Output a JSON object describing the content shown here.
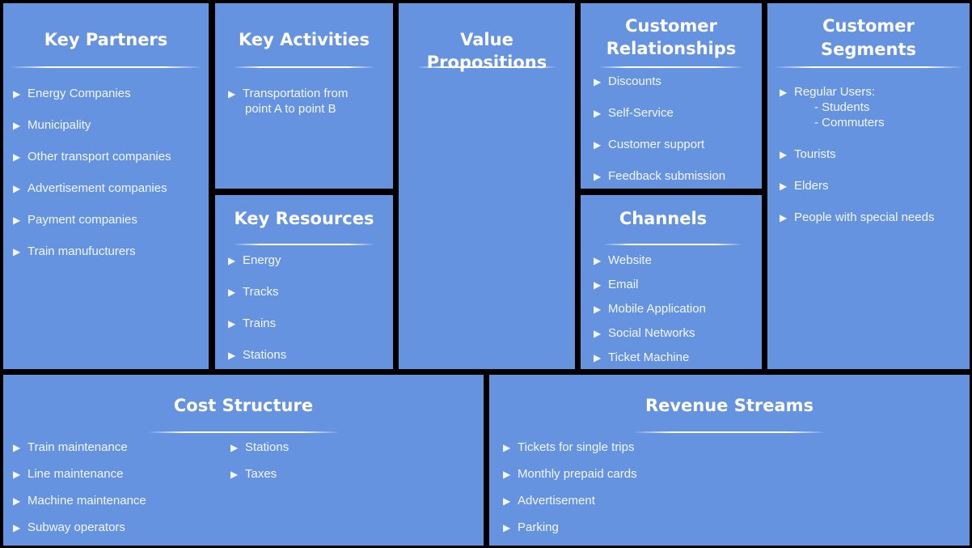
{
  "key_partners": {
    "title": "Key Partners",
    "items": [
      "Energy Companies",
      "Municipality",
      "Other transport companies",
      "Advertisement companies",
      "Payment companies",
      "Train manufucturers"
    ]
  },
  "key_activities": {
    "title": "Key Activities",
    "item_line1": "Transportation from",
    "item_line2": "point A to point B"
  },
  "key_resources": {
    "title": "Key Resources",
    "items": [
      "Energy",
      "Tracks",
      "Trains",
      "Stations"
    ]
  },
  "value_propositions": {
    "title": "Value Propositions"
  },
  "customer_relationships": {
    "title_line1": "Customer",
    "title_line2": "Relationships",
    "items": [
      "Discounts",
      "Self-Service",
      "Customer support",
      "Feedback submission"
    ]
  },
  "channels": {
    "title": "Channels",
    "items": [
      "Website",
      "Email",
      "Mobile Application",
      "Social Networks",
      "Ticket Machine"
    ]
  },
  "customer_segments": {
    "title_line1": "Customer",
    "title_line2": "Segments",
    "regular_users": "Regular Users:",
    "sub_items": [
      "- Students",
      "- Commuters"
    ],
    "items": [
      "Tourists",
      "Elders",
      "People with special needs"
    ]
  },
  "cost_structure": {
    "title": "Cost Structure",
    "col1": [
      "Train maintenance",
      "Line maintenance",
      "Machine maintenance",
      "Subway operators"
    ],
    "col2": [
      "Stations",
      "Taxes"
    ]
  },
  "revenue_streams": {
    "title": "Revenue Streams",
    "items": [
      "Tickets for single trips",
      "Monthly prepaid cards",
      "Advertisement",
      "Parking"
    ]
  },
  "bullet": "▶",
  "colors": {
    "panel": "#6593e0",
    "border": "#000000",
    "text": "#ffffff"
  }
}
